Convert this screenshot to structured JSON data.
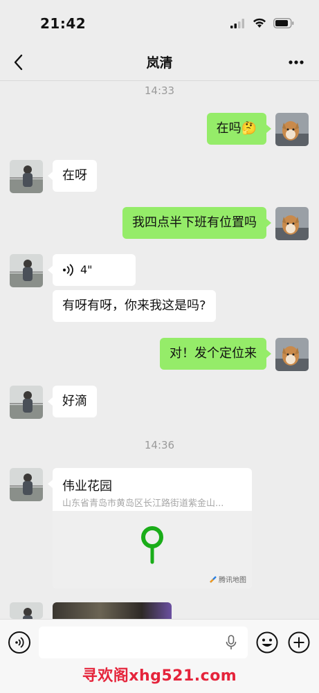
{
  "status": {
    "time": "21:42"
  },
  "header": {
    "title": "岚清"
  },
  "chat": {
    "timestamps": [
      "14:33",
      "14:36"
    ],
    "messages": [
      {
        "dir": "out",
        "text": "在吗🤔"
      },
      {
        "dir": "in",
        "text": "在呀"
      },
      {
        "dir": "out",
        "text": "我四点半下班有位置吗"
      },
      {
        "dir": "in",
        "type": "voice",
        "duration": "4\""
      },
      {
        "dir": "in",
        "text": "有呀有呀，你来我这是吗?"
      },
      {
        "dir": "out",
        "text": "对！发个定位来"
      },
      {
        "dir": "in",
        "text": "好滴"
      }
    ],
    "location": {
      "name": "伟业花园",
      "address": "山东省青岛市黄岛区长江路街道紫金山...",
      "map_brand": "腾讯地图"
    }
  },
  "colors": {
    "accent": "#95ec69",
    "pin": "#1aad19",
    "watermark": "#e5243b"
  },
  "watermark": "寻欢阁xhg521.com"
}
